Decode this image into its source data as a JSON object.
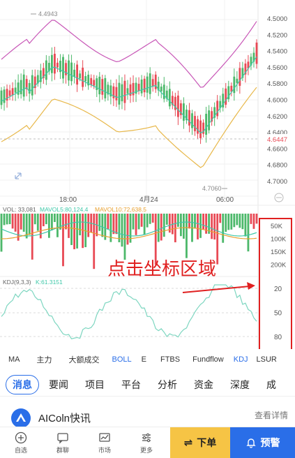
{
  "chart": {
    "price_labels": [
      "4.5000",
      "4.5200",
      "4.5400",
      "4.5600",
      "4.5800",
      "4.6000",
      "4.6200",
      "4.6400",
      "4.6600",
      "4.6800",
      "4.7000"
    ],
    "current_price": "4.6447",
    "high_label": "4.4943",
    "low_label": "4.7060",
    "time_labels": [
      "18:00",
      "4月24",
      "06:00"
    ],
    "volume_legend": {
      "vol": "VOL: 33,081",
      "mavol5": "MAVOL5:80,124.4",
      "mavol10": "MAVOL10:72,638.5"
    },
    "volume_labels": [
      "50K",
      "100K",
      "150K",
      "200K"
    ],
    "kdj_legend": {
      "params": "KDJ(9,3,3)",
      "k": "K:61.3151"
    },
    "kdj_labels": [
      "20",
      "50",
      "80"
    ],
    "annotation": "点击坐标区域",
    "colors": {
      "up": "#e84a55",
      "down": "#4cb86a",
      "mid_band": "#3ec8a8",
      "upper_band": "#c857b7",
      "lower_band": "#e8b84a",
      "annotation": "#e02020",
      "price_tag": "#e84a55"
    }
  },
  "indicators": [
    "MA",
    "主力",
    "大额成交",
    "BOLL",
    "E",
    "FTBS",
    "Fundflow",
    "KDJ",
    "LSUR"
  ],
  "indicators_active": [
    "BOLL",
    "KDJ"
  ],
  "tabs": [
    "消息",
    "要闻",
    "项目",
    "平台",
    "分析",
    "资金",
    "深度",
    "成"
  ],
  "tabs_active": "消息",
  "news": {
    "source": "AIColn快讯",
    "more": "查看详情"
  },
  "nav": {
    "items": [
      "自选",
      "群聊",
      "市场",
      "更多"
    ],
    "order": "下单",
    "alert": "预警"
  }
}
